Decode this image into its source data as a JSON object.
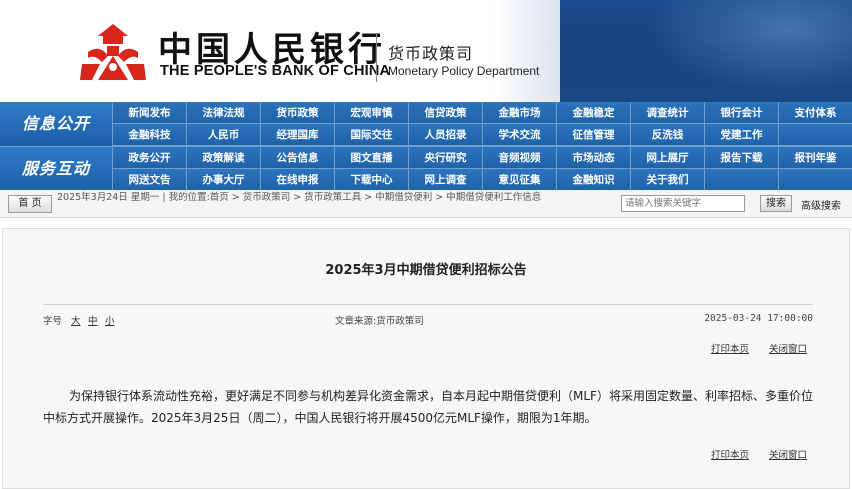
{
  "header": {
    "bank_name_cn": "中国人民银行",
    "bank_name_en": "THE PEOPLE'S BANK OF CHINA",
    "department_cn": "货币政策司",
    "department_en": "Monetary Policy Department",
    "logo_icon": "pboc-emblem-icon",
    "colors": {
      "header_blue": "#1a4a86",
      "logo_red": "#d9261c"
    }
  },
  "nav": {
    "section1_label": "信息公开",
    "section2_label": "服务互动",
    "section1_items": [
      "新闻发布",
      "法律法规",
      "货币政策",
      "宏观审慎",
      "信贷政策",
      "金融市场",
      "金融稳定",
      "调查统计",
      "银行会计",
      "支付体系",
      "金融科技",
      "人民币",
      "经理国库",
      "国际交往",
      "人员招录",
      "学术交流",
      "征信管理",
      "反洗钱",
      "党建工作",
      ""
    ],
    "section2_items": [
      "政务公开",
      "政策解读",
      "公告信息",
      "图文直播",
      "央行研究",
      "音频视频",
      "市场动态",
      "网上展厅",
      "报告下载",
      "报刊年鉴",
      "网送文告",
      "办事大厅",
      "在线申报",
      "下载中心",
      "网上调查",
      "意见征集",
      "金融知识",
      "关于我们",
      "",
      ""
    ],
    "colors": {
      "nav_blue": "#1f62a8",
      "divider": "#6f9fd1"
    }
  },
  "breadcrumb": {
    "home_button": "首 页",
    "text": "2025年3月24日  星期一  |  我的位置:首页  >  货币政策司  >  货币政策工具  >  中期借贷便利  >  中期借贷便利工作信息",
    "search_placeholder": "请输入搜索关键字",
    "search_button": "搜索",
    "advanced_search": "高级搜索"
  },
  "article": {
    "title": "2025年3月中期借贷便利招标公告",
    "font_size_label": "字号",
    "font_sizes": [
      "大",
      "中",
      "小"
    ],
    "source": "文章来源:货币政策司",
    "date": "2025-03-24 17:00:00",
    "print_label": "打印本页",
    "close_label": "关闭窗口",
    "body": "为保持银行体系流动性充裕，更好满足不同参与机构差异化资金需求，自本月起中期借贷便利（MLF）将采用固定数量、利率招标、多重价位中标方式开展操作。2025年3月25日（周二），中国人民银行将开展4500亿元MLF操作，期限为1年期。"
  }
}
